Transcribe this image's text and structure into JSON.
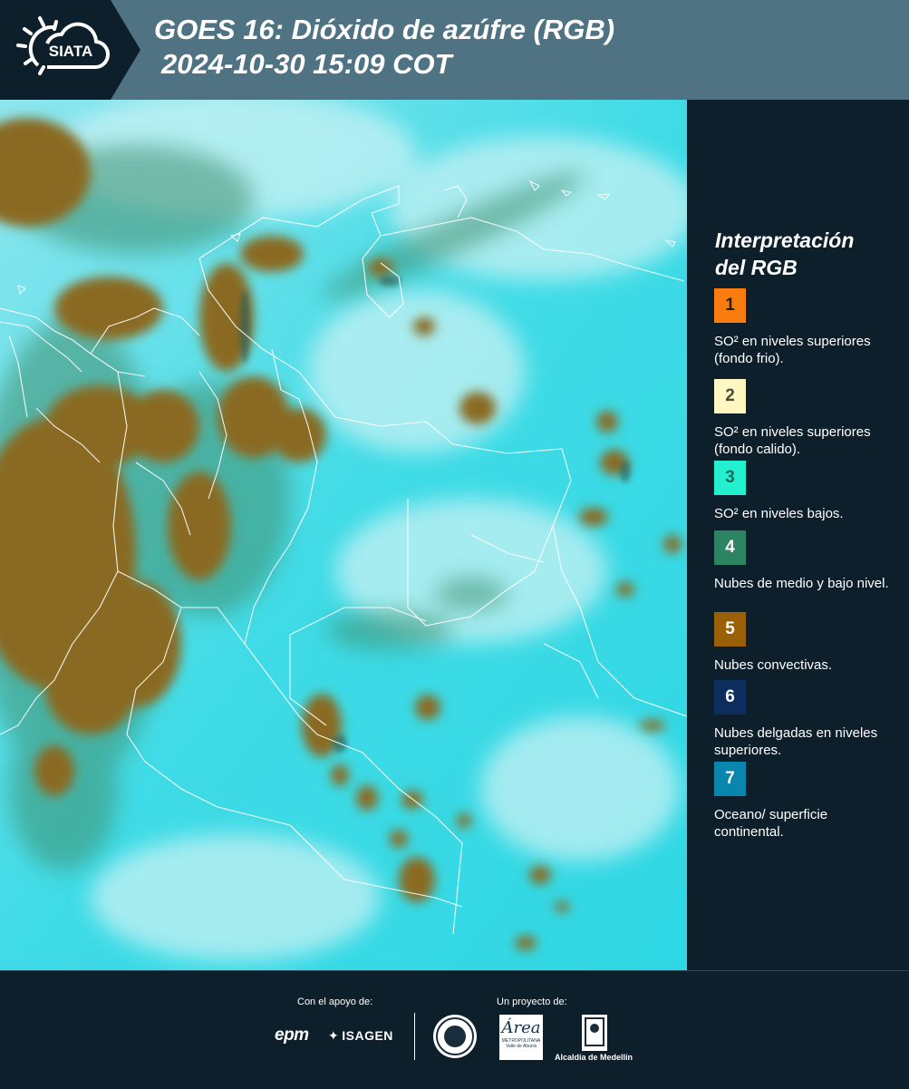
{
  "header": {
    "logo_text": "SIATA",
    "title_line1": "GOES 16: Dióxido de azúfre (RGB)",
    "title_line2": "2024-10-30 15:09 COT"
  },
  "legend": {
    "title_line1": "Interpretación",
    "title_line2": "del RGB",
    "items": [
      {
        "num": "1",
        "color": "#f97d0e",
        "num_color": "#2a1c10",
        "label": "SO² en niveles superiores (fondo frio)."
      },
      {
        "num": "2",
        "color": "#fff7c2",
        "num_color": "#4a4a3a",
        "label": "SO² en niveles superiores (fondo calido)."
      },
      {
        "num": "3",
        "color": "#23f0cf",
        "num_color": "#26635a",
        "label": "SO² en niveles bajos."
      },
      {
        "num": "4",
        "color": "#2d8462",
        "num_color": "#ffffff",
        "label": "Nubes de medio y bajo nivel."
      },
      {
        "num": "5",
        "color": "#996008",
        "num_color": "#ffffff",
        "label": "Nubes convectivas."
      },
      {
        "num": "6",
        "color": "#0d2d5e",
        "num_color": "#ffffff",
        "label": "Nubes delgadas en niveles superiores."
      },
      {
        "num": "7",
        "color": "#0a85ae",
        "num_color": "#ffffff",
        "label": "Oceano/ superficie continental."
      }
    ]
  },
  "footer": {
    "support_label": "Con el apoyo de:",
    "project_label": "Un proyecto de:",
    "sponsor1": "epm",
    "sponsor2": "ISAGEN",
    "partner_area": "Área",
    "partner_area_sub": "METROPOLITANA Valle de Aburrá",
    "partner_alcaldia": "Alcaldía de Medellín"
  },
  "colors": {
    "header_bg": "#4f7383",
    "panel_bg": "#0e1f2c",
    "sea_land": "#37d5e3",
    "convective": "#8a6a22",
    "mid_low": "#3f8f6e",
    "thin_high": "#5a8a9a"
  }
}
